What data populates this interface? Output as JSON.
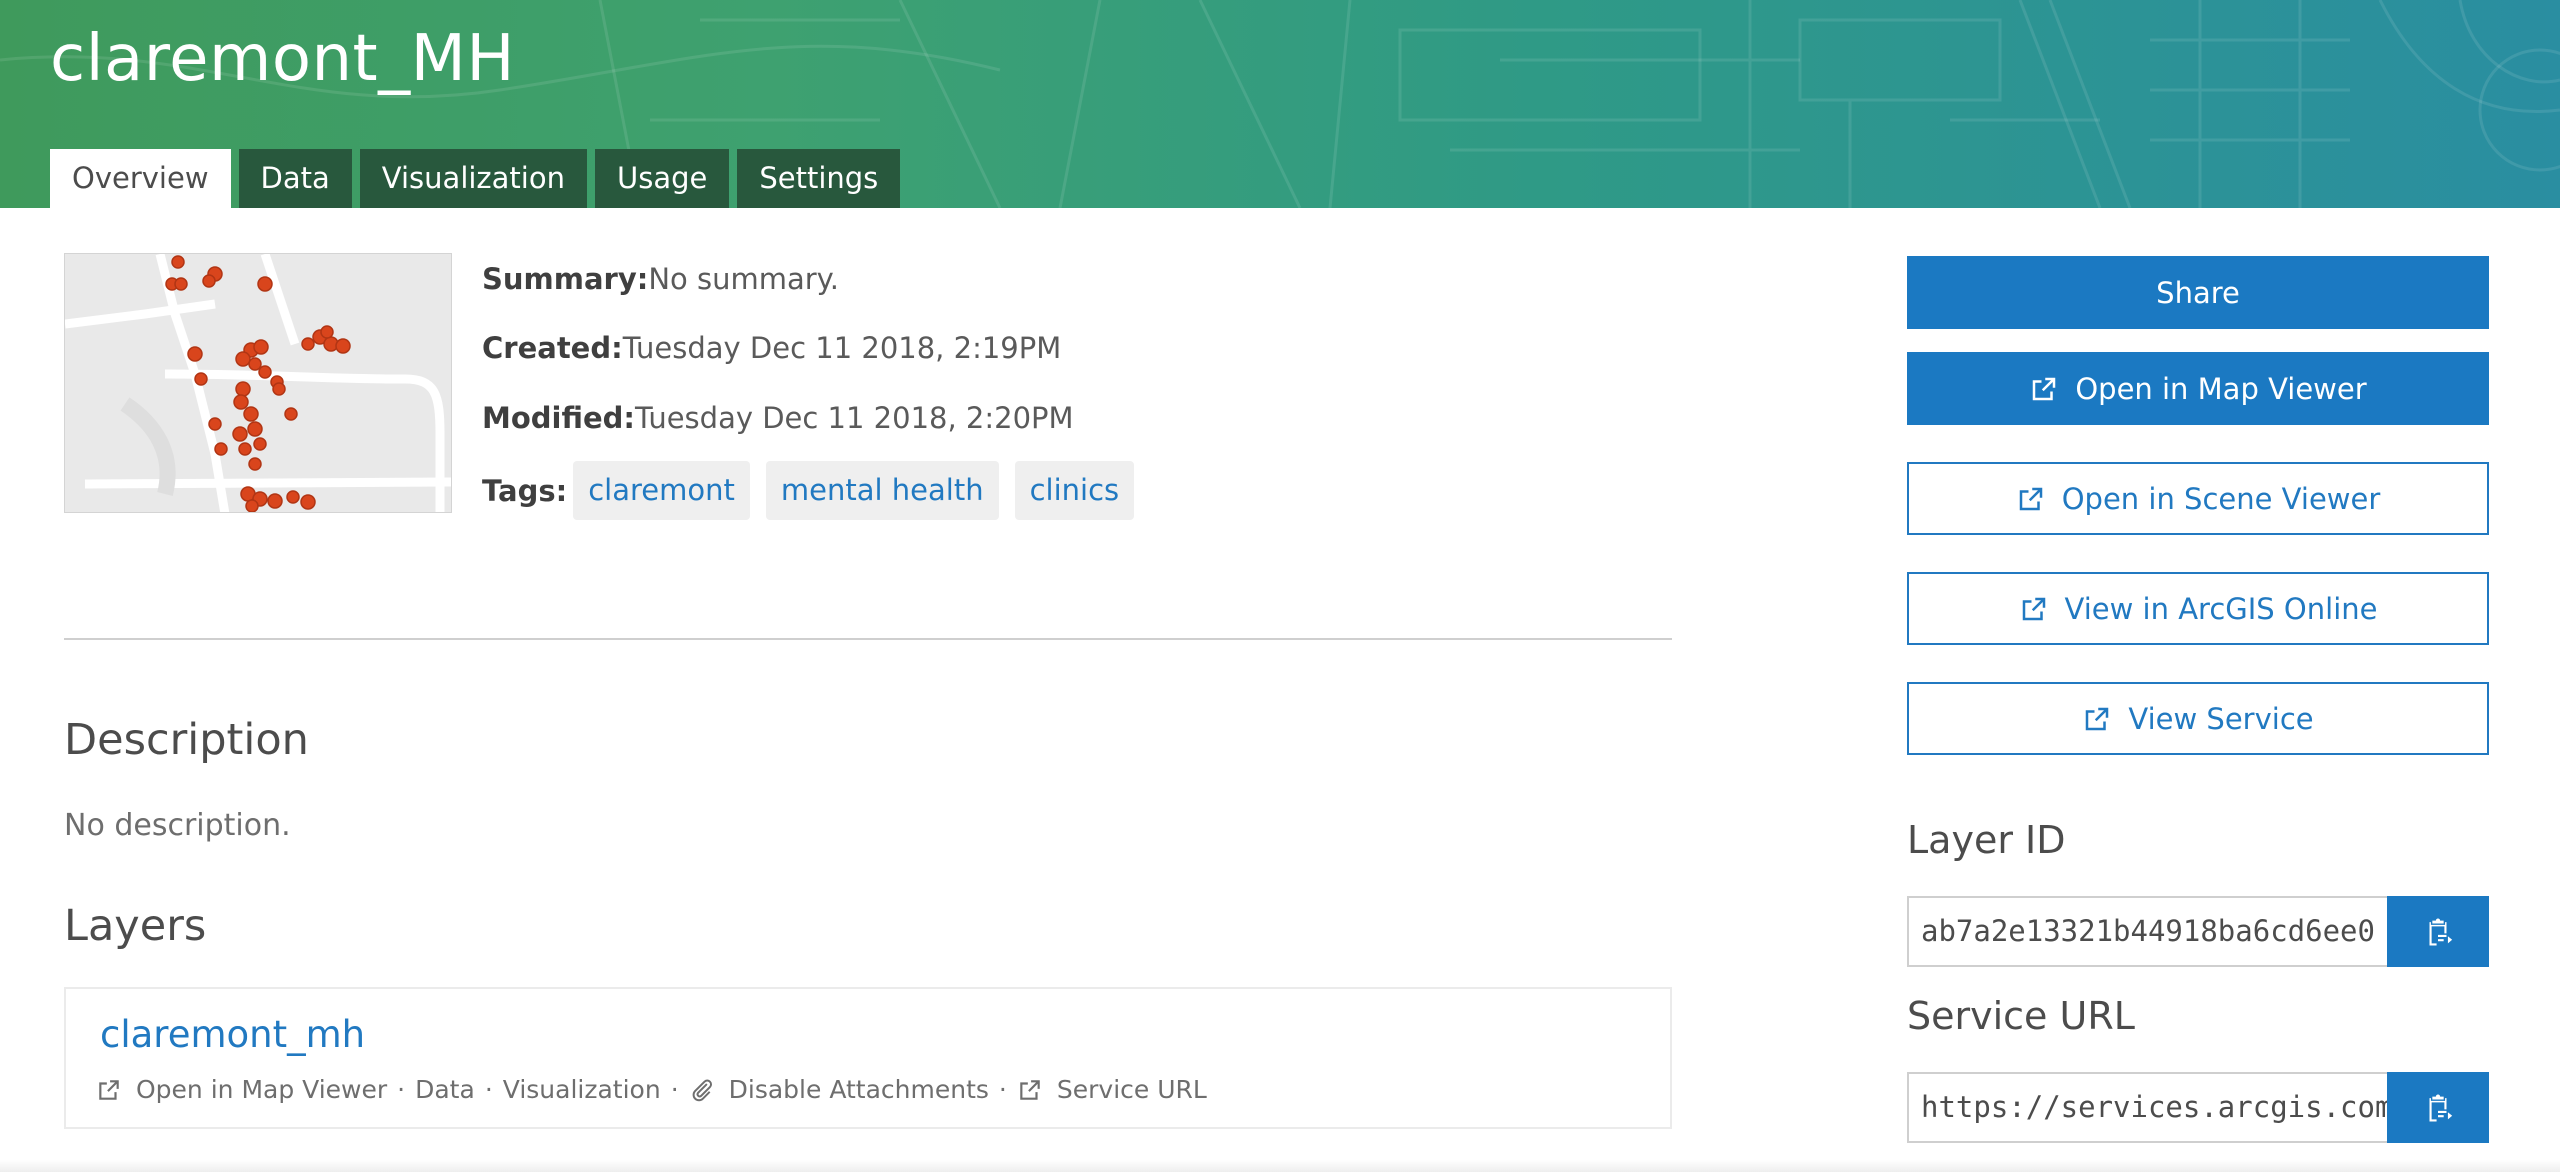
{
  "header": {
    "title": "claremont_MH",
    "tabs": [
      {
        "label": "Overview",
        "active": true
      },
      {
        "label": "Data",
        "active": false
      },
      {
        "label": "Visualization",
        "active": false
      },
      {
        "label": "Usage",
        "active": false
      },
      {
        "label": "Settings",
        "active": false
      }
    ]
  },
  "details": {
    "summary_label": "Summary:",
    "summary_value": "No summary.",
    "created_label": "Created:",
    "created_value": "Tuesday Dec 11 2018, 2:19PM",
    "modified_label": "Modified:",
    "modified_value": "Tuesday Dec 11 2018, 2:20PM",
    "tags_label": "Tags:",
    "tags": [
      "claremont",
      "mental health",
      "clinics"
    ]
  },
  "description": {
    "heading": "Description",
    "text": "No description."
  },
  "layers": {
    "heading": "Layers",
    "items": [
      {
        "name": "claremont_mh",
        "actions": [
          "Open in Map Viewer",
          "Data",
          "Visualization",
          "Disable Attachments",
          "Service URL"
        ]
      }
    ]
  },
  "sidebar": {
    "share": "Share",
    "open_map_viewer": "Open in Map Viewer",
    "open_scene_viewer": "Open in Scene Viewer",
    "view_arcgis_online": "View in ArcGIS Online",
    "view_service": "View Service",
    "layer_id_label": "Layer ID",
    "layer_id_value": "ab7a2e13321b44918ba6cd6ee0",
    "service_url_label": "Service URL",
    "service_url_value": "https://services.arcgis.com"
  },
  "colors": {
    "accent": "#1b79c2",
    "tab_bg": "#28583d",
    "header_start": "#3f9a5c",
    "header_end": "#2a8ea1",
    "marker": "#d9451c"
  },
  "icons": [
    "launch-icon",
    "paperclip-icon",
    "copy-icon"
  ]
}
